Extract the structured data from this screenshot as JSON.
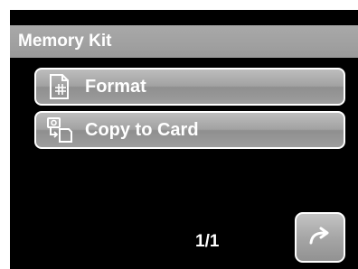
{
  "header": {
    "title": "Memory Kit"
  },
  "menu": {
    "items": [
      {
        "label": "Format",
        "icon": "format-icon"
      },
      {
        "label": "Copy to Card",
        "icon": "copy-to-card-icon"
      }
    ]
  },
  "footer": {
    "page": "1/1",
    "return_icon": "return-arrow-icon"
  },
  "colors": {
    "background": "#000000",
    "bar": "#a0a0a0",
    "text": "#ffffff"
  }
}
